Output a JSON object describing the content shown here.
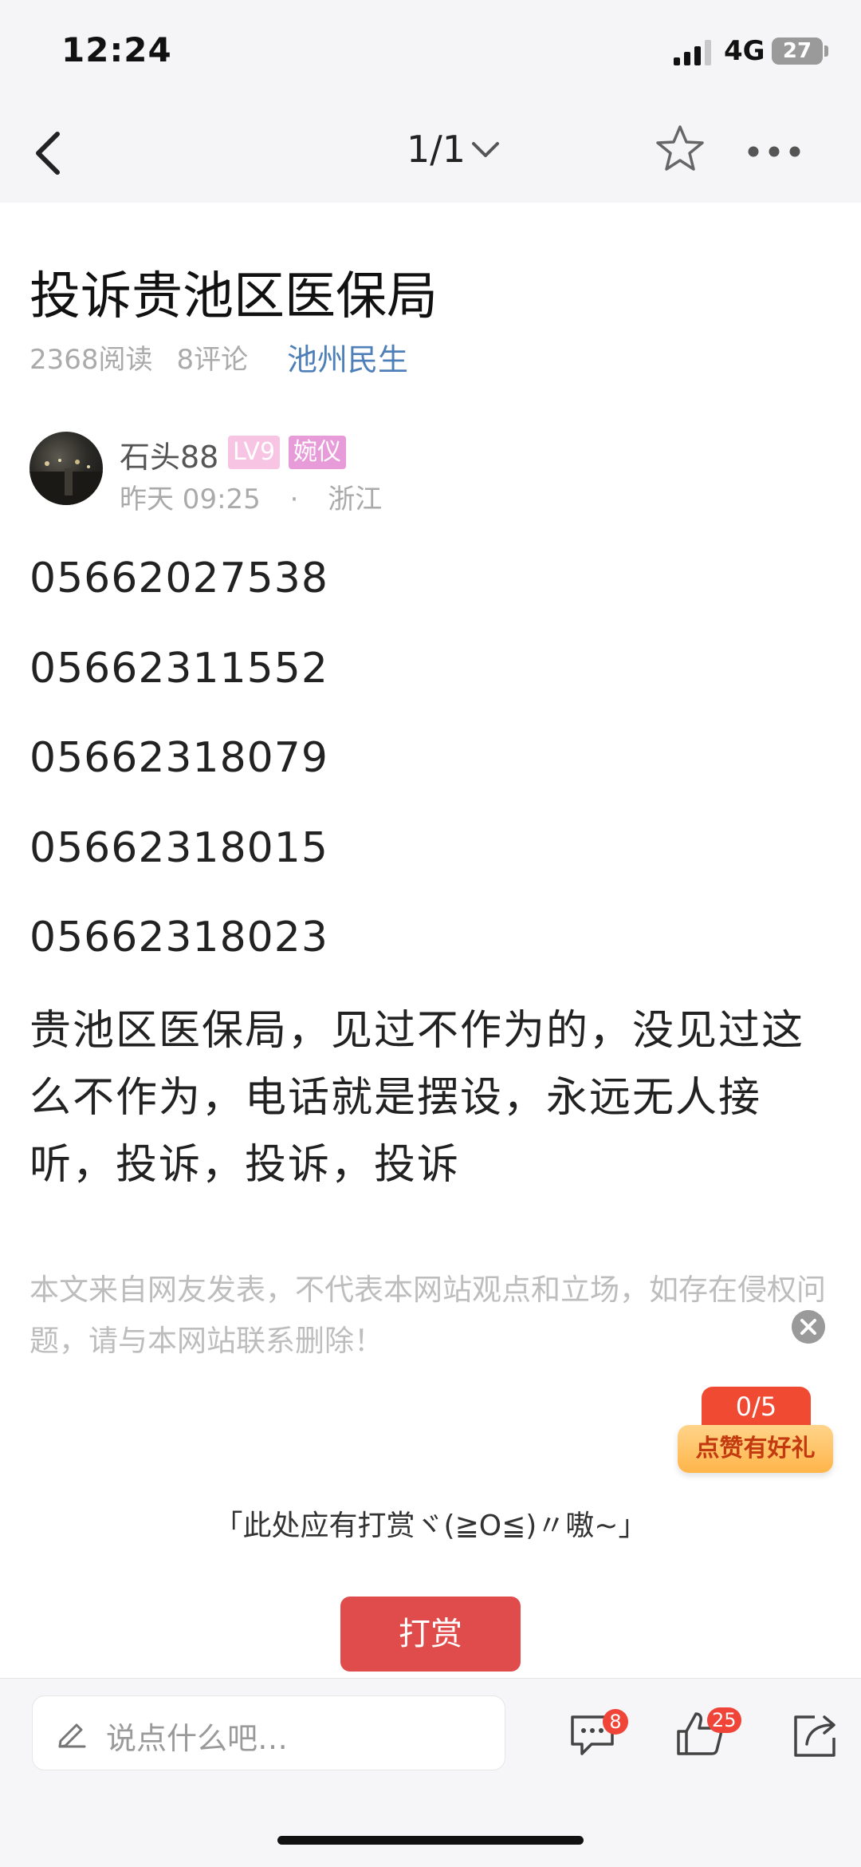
{
  "status_bar": {
    "time": "12:24",
    "network": "4G",
    "battery": "27"
  },
  "nav": {
    "pager": "1/1"
  },
  "post": {
    "title": "投诉贵池区医保局",
    "reads": "2368阅读",
    "comments": "8评论",
    "category": "池州民生",
    "author": "石头88",
    "level": "LV9",
    "tag": "婉仪",
    "date": "昨天 09:25",
    "dot": "·",
    "location": "浙江",
    "phones": [
      "05662027538",
      "05662311552",
      "05662318079",
      "05662318015",
      "05662318023"
    ],
    "body": "贵池区医保局，见过不作为的，没见过这么不作为，电话就是摆设，永远无人接听，投诉，投诉，投诉",
    "disclaimer": "本文来自网友发表，不代表本网站观点和立场，如存在侵权问题，请与本网站联系删除！"
  },
  "like_gift": {
    "progress": "0/5",
    "label": "点赞有好礼"
  },
  "reward": {
    "text": "「此处应有打赏ヾ(≧O≦)〃嗷~」",
    "button": "打赏"
  },
  "bottom_bar": {
    "placeholder": "说点什么吧…",
    "comment_count": "8",
    "like_count": "25"
  },
  "colors": {
    "accent_red": "#e04b4b",
    "link_blue": "#4e7fb8",
    "badge_red": "#f04438"
  }
}
